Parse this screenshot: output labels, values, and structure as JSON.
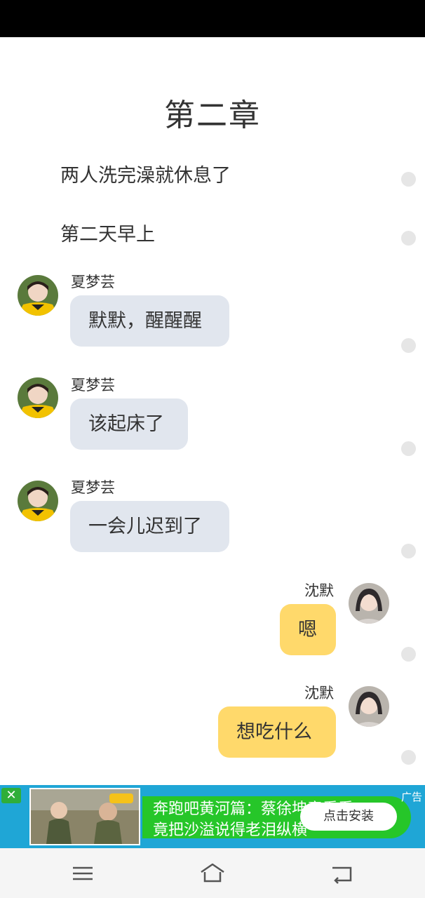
{
  "chapter": {
    "title": "第二章"
  },
  "narrations": [
    "两人洗完澡就休息了",
    "第二天早上"
  ],
  "messages": [
    {
      "speaker": "夏梦芸",
      "text": "默默，醒醒醒",
      "side": "left"
    },
    {
      "speaker": "夏梦芸",
      "text": "该起床了",
      "side": "left"
    },
    {
      "speaker": "夏梦芸",
      "text": "一会儿迟到了",
      "side": "left"
    },
    {
      "speaker": "沈默",
      "text": "嗯",
      "side": "right"
    },
    {
      "speaker": "沈默",
      "text": "想吃什么",
      "side": "right"
    }
  ],
  "ad": {
    "line1": "奔跑吧黄河篇：蔡徐坤竟看看",
    "line2": "竟把沙溢说得老泪纵横",
    "install_label": "点击安装",
    "ad_tag": "广告"
  },
  "icons": {
    "close": "close-icon",
    "menu": "menu-icon",
    "home": "home-icon",
    "back": "back-icon"
  },
  "colors": {
    "left_bubble": "#e1e6ee",
    "right_bubble": "#ffd96b",
    "ad_background": "#1fa6d6",
    "ad_green": "#26c629"
  }
}
